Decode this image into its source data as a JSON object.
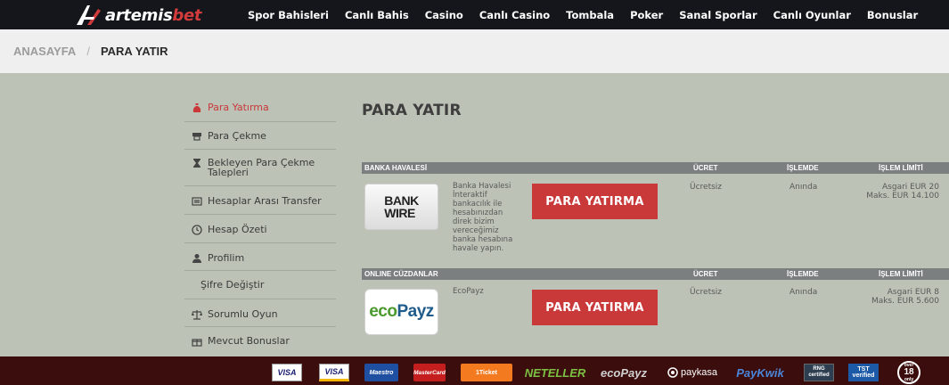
{
  "brand": {
    "name_prefix": "artemis",
    "name_suffix": "bet"
  },
  "nav": [
    "Spor Bahisleri",
    "Canlı Bahis",
    "Casino",
    "Canlı Casino",
    "Tombala",
    "Poker",
    "Sanal Sporlar",
    "Canlı Oyunlar",
    "Bonuslar"
  ],
  "breadcrumb": {
    "home": "ANASAYFA",
    "separator": "/",
    "current": "PARA YATIR"
  },
  "sidebar": {
    "items": [
      {
        "label": "Para Yatırma",
        "icon": "money-bag-icon",
        "active": true
      },
      {
        "label": "Para Çekme",
        "icon": "atm-icon",
        "active": false
      },
      {
        "label": "Bekleyen Para Çekme Talepleri",
        "icon": "hourglass-icon",
        "active": false
      },
      {
        "label": "Hesaplar Arası Transfer",
        "icon": "transfer-icon",
        "active": false
      },
      {
        "label": "Hesap Özeti",
        "icon": "clock-icon",
        "active": false
      },
      {
        "label": "Profilim",
        "icon": "user-icon",
        "active": false
      },
      {
        "label": "Şifre Değiştir",
        "icon": "",
        "active": false
      },
      {
        "label": "Sorumlu Oyun",
        "icon": "scale-icon",
        "active": false
      },
      {
        "label": "Mevcut Bonuslar",
        "icon": "gift-icon",
        "active": false
      }
    ]
  },
  "main": {
    "title": "PARA YATIR",
    "columns": {
      "fee": "ÜCRET",
      "processing": "İŞLEMDE",
      "limit": "İŞLEM LİMİTİ"
    },
    "sections": [
      {
        "heading": "BANKA HAVALESİ",
        "method": {
          "logo_line1": "BANK",
          "logo_line2": "WIRE",
          "description": "Banka Havalesi İnteraktif bankacılık ile hesabınızdan direk bizim vereceğimiz banka hesabına havale yapın.",
          "button": "PARA YATIRMA",
          "fee": "Ücretsiz",
          "processing": "Anında",
          "limit_min": "Asgari EUR 20",
          "limit_max": "Maks. EUR 14.100"
        }
      },
      {
        "heading": "ONLINE CÜZDANLAR",
        "method": {
          "logo_eco": "eco",
          "logo_payz": "Payz",
          "description": "EcoPayz",
          "button": "PARA YATIRMA",
          "fee": "Ücretsiz",
          "processing": "Anında",
          "limit_min": "Asgari EUR 8",
          "limit_max": "Maks. EUR 5.600"
        }
      }
    ]
  },
  "footer": {
    "payments": {
      "visa1": "VISA",
      "visa2": "VISA",
      "maestro": "Maestro",
      "mastercard": "MasterCard",
      "ticket": "1Ticket",
      "neteller": "NETELLER",
      "ecopayz": "ecoPayz",
      "paykasa": "paykasa",
      "paykwik": "PayKwik",
      "rng_1": "RNG",
      "rng_2": "certified",
      "tst_1": "TST",
      "tst_2": "verified",
      "age": "18",
      "age_sm": "only",
      "age_over": "over"
    }
  },
  "colors": {
    "accent": "#c9393a",
    "topbar": "#14161b",
    "page_bg": "#bcc2b6",
    "footer_bg": "#3b0d0d"
  }
}
